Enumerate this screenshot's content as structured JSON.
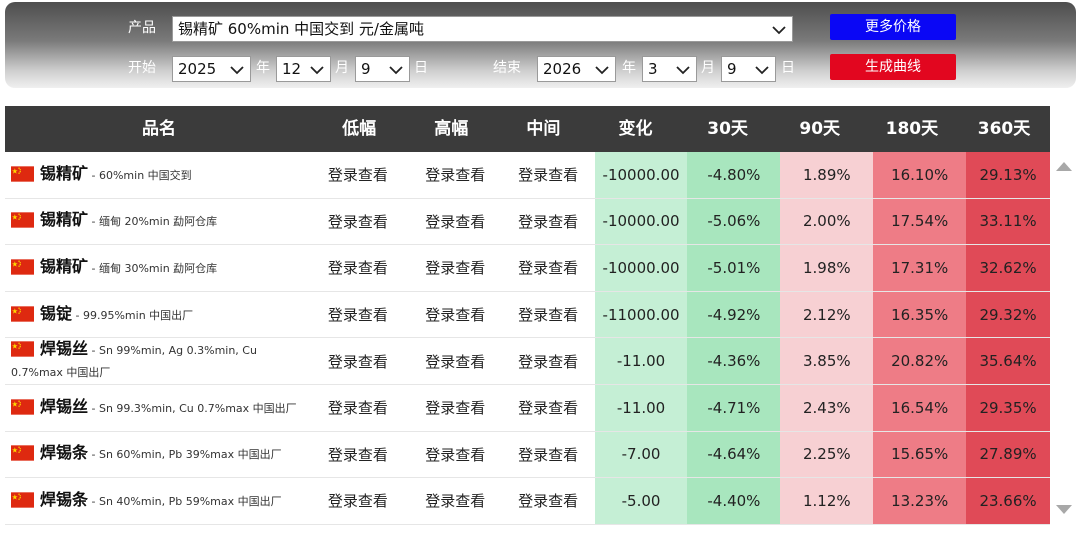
{
  "filters": {
    "product_label": "产品",
    "product_value": "锡精矿 60%min 中国交到 元/金属吨",
    "start_label": "开始",
    "start_year": "2025",
    "start_month": "12",
    "start_day": "9",
    "end_label": "结束",
    "end_year": "2026",
    "end_month": "3",
    "end_day": "9",
    "year_unit": "年",
    "month_unit": "月",
    "day_unit": "日",
    "more_prices_button": "更多价格",
    "generate_curve_button": "生成曲线"
  },
  "table": {
    "headers": [
      "品名",
      "低幅",
      "高幅",
      "中间",
      "变化",
      "30天",
      "90天",
      "180天",
      "360天"
    ],
    "rows": [
      {
        "name": "锡精矿",
        "spec": " - 60%min 中国交到",
        "low": "登录查看",
        "high": "登录查看",
        "mid": "登录查看",
        "change": "-10000.00",
        "d30": "-4.80%",
        "d90": "1.89%",
        "d180": "16.10%",
        "d360": "29.13%"
      },
      {
        "name": "锡精矿",
        "spec": " - 缅甸 20%min 勐阿仓库",
        "low": "登录查看",
        "high": "登录查看",
        "mid": "登录查看",
        "change": "-10000.00",
        "d30": "-5.06%",
        "d90": "2.00%",
        "d180": "17.54%",
        "d360": "33.11%"
      },
      {
        "name": "锡精矿",
        "spec": " - 缅甸 30%min 勐阿仓库",
        "low": "登录查看",
        "high": "登录查看",
        "mid": "登录查看",
        "change": "-10000.00",
        "d30": "-5.01%",
        "d90": "1.98%",
        "d180": "17.31%",
        "d360": "32.62%"
      },
      {
        "name": "锡锭",
        "spec": " - 99.95%min 中国出厂",
        "low": "登录查看",
        "high": "登录查看",
        "mid": "登录查看",
        "change": "-11000.00",
        "d30": "-4.92%",
        "d90": "2.12%",
        "d180": "16.35%",
        "d360": "29.32%"
      },
      {
        "name": "焊锡丝",
        "spec": " - Sn 99%min, Ag 0.3%min, Cu 0.7%max 中国出厂",
        "low": "登录查看",
        "high": "登录查看",
        "mid": "登录查看",
        "change": "-11.00",
        "d30": "-4.36%",
        "d90": "3.85%",
        "d180": "20.82%",
        "d360": "35.64%"
      },
      {
        "name": "焊锡丝",
        "spec": " - Sn 99.3%min, Cu 0.7%max 中国出厂",
        "low": "登录查看",
        "high": "登录查看",
        "mid": "登录查看",
        "change": "-11.00",
        "d30": "-4.71%",
        "d90": "2.43%",
        "d180": "16.54%",
        "d360": "29.35%"
      },
      {
        "name": "焊锡条",
        "spec": " - Sn 60%min, Pb 39%max 中国出厂",
        "low": "登录查看",
        "high": "登录查看",
        "mid": "登录查看",
        "change": "-7.00",
        "d30": "-4.64%",
        "d90": "2.25%",
        "d180": "15.65%",
        "d360": "27.89%"
      },
      {
        "name": "焊锡条",
        "spec": " - Sn 40%min, Pb 59%max 中国出厂",
        "low": "登录查看",
        "high": "登录查看",
        "mid": "登录查看",
        "change": "-5.00",
        "d30": "-4.40%",
        "d90": "1.12%",
        "d180": "13.23%",
        "d360": "23.66%"
      }
    ]
  },
  "colors": {
    "header_bg": "#3b3b3b",
    "change_bg": "#c5efd5",
    "d30_bg": "#a8e6be",
    "d90_bg": "#f7d0d3",
    "d180_bg": "#ee7c86",
    "d360_bg": "#e04a57",
    "button_blue": "#0a07f5",
    "button_red": "#e2061f"
  },
  "icons": {
    "flag": "china-flag-icon",
    "dropdown": "chevron-down-icon",
    "scroll_up": "scroll-up-icon",
    "scroll_down": "scroll-down-icon"
  }
}
